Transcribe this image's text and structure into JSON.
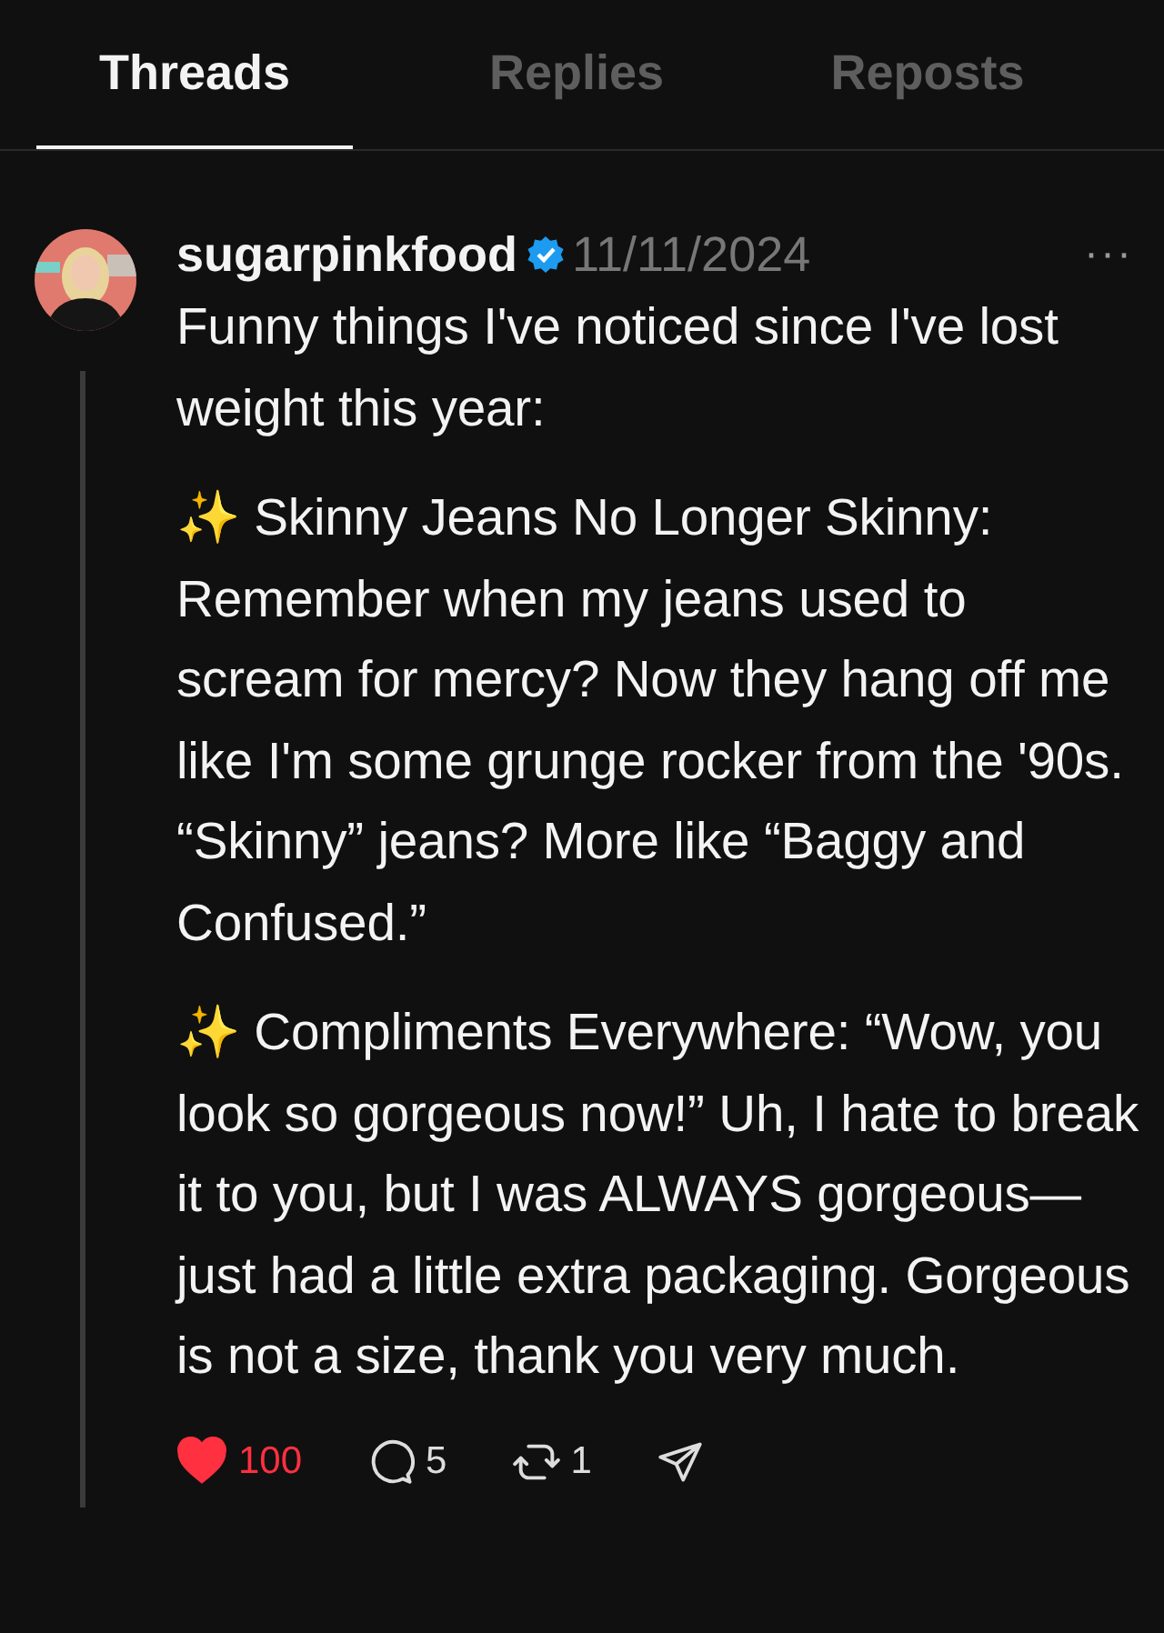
{
  "tabs": [
    {
      "label": "Threads",
      "selected": true
    },
    {
      "label": "Replies",
      "selected": false
    },
    {
      "label": "Reposts",
      "selected": false
    }
  ],
  "post": {
    "avatar": {
      "kind": "picture"
    },
    "username": "sugarpinkfood",
    "verified": true,
    "date": "11/11/2024",
    "more": "···",
    "paragraphs": [
      "Funny things I've noticed since I've lost weight this year:",
      "✨ Skinny Jeans No Longer Skinny: Remember when my jeans used to scream for mercy? Now they hang off me like I'm some grunge rocker from the '90s. “Skinny” jeans? More like “Baggy and Confused.”",
      "✨ Compliments Everywhere: “Wow, you look so gorgeous now!” Uh, I hate to break it to you, but I was ALWAYS gorgeous—just had a little extra packaging. Gorgeous is not a size, thank you very much."
    ],
    "actions": [
      {
        "kind": "like",
        "count": "100",
        "selected": true
      },
      {
        "kind": "reply",
        "count": "5"
      },
      {
        "kind": "repost",
        "count": "1"
      },
      {
        "kind": "share"
      }
    ]
  }
}
